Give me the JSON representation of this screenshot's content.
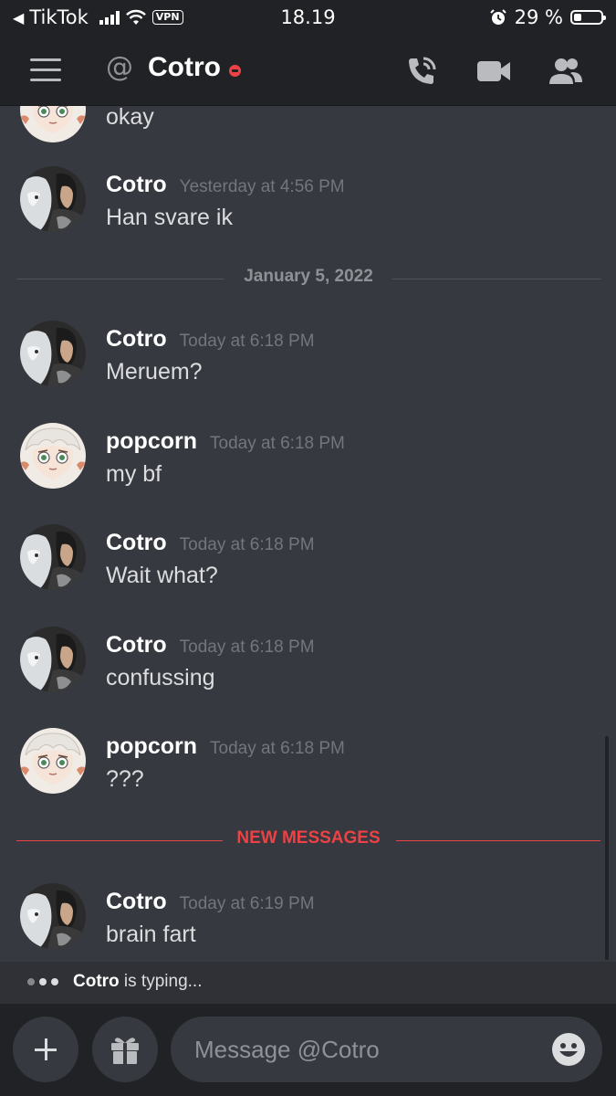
{
  "status_bar": {
    "back_app": "TikTok",
    "vpn": "VPN",
    "time": "18.19",
    "battery_text": "29 %",
    "battery_level": 0.29
  },
  "header": {
    "at_symbol": "@",
    "title": "Cotro",
    "icons": [
      "hamburger-menu-icon",
      "phone-call-icon",
      "video-camera-icon",
      "members-icon"
    ]
  },
  "messages": [
    {
      "author": "",
      "time": "",
      "text": "okay",
      "avatar": "popcorn"
    },
    {
      "author": "Cotro",
      "time": "Yesterday at 4:56 PM",
      "text": "Han svare ik",
      "avatar": "cotro"
    },
    {
      "author": "Cotro",
      "time": "Today at 6:18 PM",
      "text": "Meruem?",
      "avatar": "cotro"
    },
    {
      "author": "popcorn",
      "time": "Today at 6:18 PM",
      "text": "my bf",
      "avatar": "popcorn"
    },
    {
      "author": "Cotro",
      "time": "Today at 6:18 PM",
      "text": "Wait what?",
      "avatar": "cotro"
    },
    {
      "author": "Cotro",
      "time": "Today at 6:18 PM",
      "text": "confussing",
      "avatar": "cotro"
    },
    {
      "author": "popcorn",
      "time": "Today at 6:18 PM",
      "text": "???",
      "avatar": "popcorn"
    },
    {
      "author": "Cotro",
      "time": "Today at 6:19 PM",
      "text": "brain fart",
      "avatar": "cotro"
    }
  ],
  "dividers": {
    "date": "January 5, 2022",
    "new_messages": "NEW MESSAGES"
  },
  "typing": {
    "user": "Cotro",
    "text": " is typing..."
  },
  "input": {
    "placeholder": "Message @Cotro"
  },
  "colors": {
    "background": "#36393f",
    "header": "#202225",
    "dnd_status": "#ed4245",
    "new_messages": "#ed4245"
  }
}
